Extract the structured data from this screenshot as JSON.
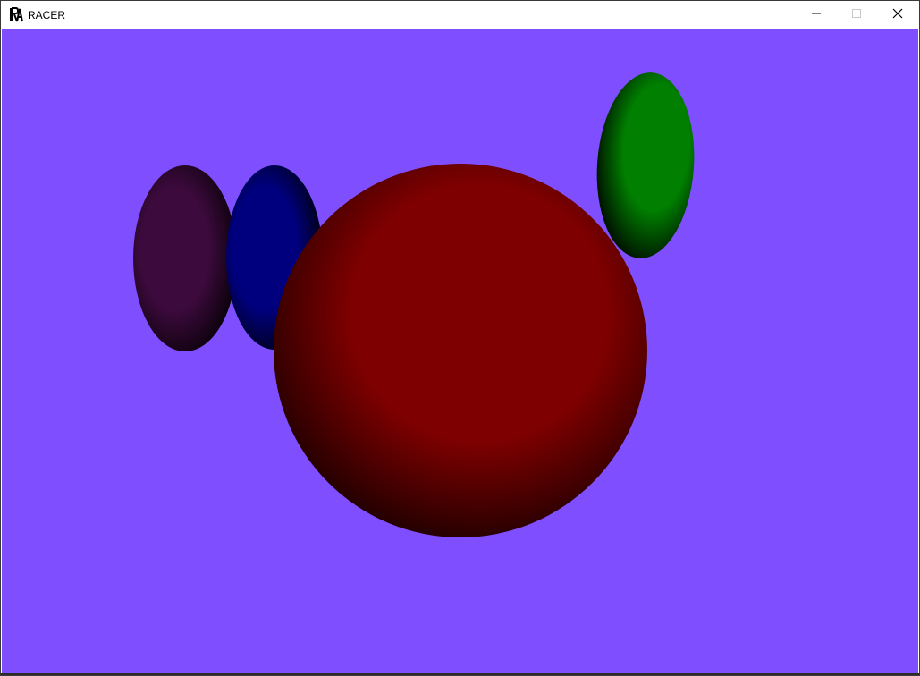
{
  "window": {
    "title": "RACER",
    "app_icon": "racer-logo-icon",
    "controls": {
      "minimize_icon": "minimize-icon",
      "maximize_icon": "maximize-icon",
      "close_icon": "close-icon"
    }
  },
  "scene": {
    "background_color": "#7f4fff",
    "spheres": [
      {
        "name": "purple-sphere",
        "color": "#3c0a3c"
      },
      {
        "name": "blue-sphere",
        "color": "#00007f"
      },
      {
        "name": "red-sphere",
        "color": "#7f0000"
      },
      {
        "name": "green-sphere",
        "color": "#007f00"
      }
    ]
  }
}
